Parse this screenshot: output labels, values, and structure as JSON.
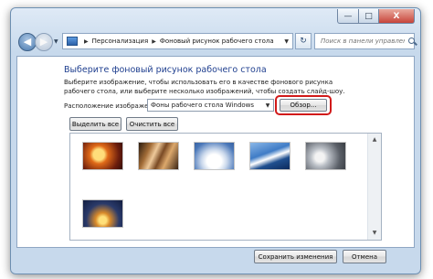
{
  "window": {
    "caption": {
      "minimize_glyph": "—",
      "maximize_glyph": "□",
      "close_glyph": "X"
    }
  },
  "navbar": {
    "back_icon": "back-arrow-icon",
    "forward_icon": "forward-arrow-icon",
    "breadcrumb": [
      "Персонализация",
      "Фоновый рисунок рабочего стола"
    ],
    "separator": "▶",
    "dropdown_glyph": "▼",
    "refresh_glyph": "↻",
    "search_placeholder": "Поиск в панели управления"
  },
  "main": {
    "title": "Выберите фоновый рисунок рабочего стола",
    "description": "Выберите изображение, чтобы использовать его в качестве фонового рисунка рабочего стола, или выберите несколько изображений, чтобы создать слайд-шоу.",
    "location_label": "Расположение изображения:",
    "location_value": "Фоны рабочего стола Windows",
    "browse_label": "Обзор...",
    "select_all_label": "Выделить все",
    "clear_all_label": "Очистить все",
    "gallery": {
      "thumbnails": [
        "wallpaper-1",
        "wallpaper-2",
        "wallpaper-3",
        "wallpaper-4",
        "wallpaper-5",
        "wallpaper-6"
      ]
    }
  },
  "footer": {
    "save_label": "Сохранить изменения",
    "cancel_label": "Отмена"
  },
  "colors": {
    "title_blue": "#1f3f8f",
    "highlight_ring": "#d11a1a",
    "frame": "#c7d9ec"
  }
}
